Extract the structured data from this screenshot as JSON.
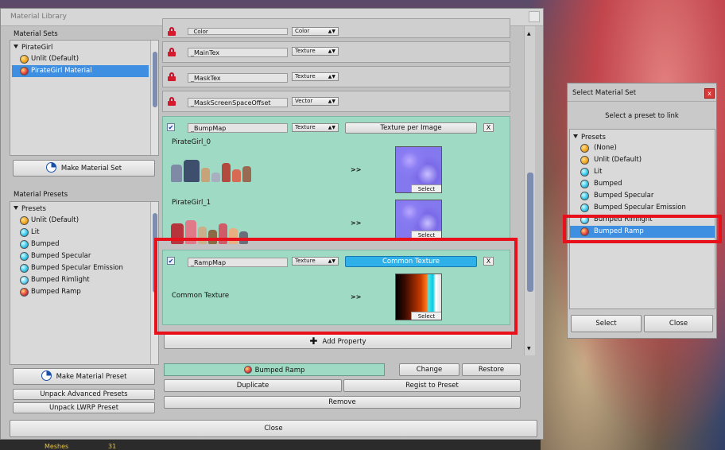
{
  "window": {
    "title": "Material Library",
    "close_label": "Close"
  },
  "material_sets": {
    "label": "Material Sets",
    "root": "PirateGirl",
    "items": [
      {
        "label": "Unlit (Default)",
        "icon": "orange-sphere-icon"
      },
      {
        "label": "PirateGirl Material",
        "icon": "ramp-sphere-icon",
        "selected": true
      }
    ],
    "make_button": "Make Material Set"
  },
  "material_presets": {
    "label": "Material Presets",
    "root": "Presets",
    "items": [
      {
        "label": "Unlit (Default)",
        "icon": "orange-sphere-icon"
      },
      {
        "label": "Lit",
        "icon": "cyan-sphere-icon"
      },
      {
        "label": "Bumped",
        "icon": "cyan-sphere-icon"
      },
      {
        "label": "Bumped Specular",
        "icon": "cyan-sphere-icon"
      },
      {
        "label": "Bumped Specular Emission",
        "icon": "cyan-sphere-icon"
      },
      {
        "label": "Bumped Rimlight",
        "icon": "rim-sphere-icon"
      },
      {
        "label": "Bumped Ramp",
        "icon": "ramp-sphere-icon"
      }
    ],
    "make_button": "Make Material Preset",
    "unpack_advanced": "Unpack Advanced Presets",
    "unpack_lwrp": "Unpack LWRP Preset"
  },
  "properties": {
    "color": {
      "name": "_Color",
      "type": "Color"
    },
    "maintex": {
      "name": "_MainTex",
      "type": "Texture"
    },
    "masktex": {
      "name": "_MaskTex",
      "type": "Texture"
    },
    "maskscreen": {
      "name": "_MaskScreenSpaceOffset",
      "type": "Vector"
    },
    "bumpmap": {
      "name": "_BumpMap",
      "type": "Texture",
      "mode": "Texture per Image",
      "remove": "X",
      "entries": [
        {
          "label": "PirateGirl_0",
          "arrow": ">>",
          "select": "Select"
        },
        {
          "label": "PirateGirl_1",
          "arrow": ">>",
          "select": "Select"
        }
      ]
    },
    "rampmap": {
      "name": "_RampMap",
      "type": "Texture",
      "mode": "Common Texture",
      "remove": "X",
      "entry": {
        "label": "Common Texture",
        "arrow": ">>",
        "select": "Select"
      }
    },
    "add_property": "Add Property"
  },
  "bottom": {
    "current_preset": "Bumped Ramp",
    "change": "Change",
    "restore": "Restore",
    "duplicate": "Duplicate",
    "regist": "Regist to Preset",
    "remove": "Remove"
  },
  "dialog": {
    "title": "Select Material Set",
    "close": "x",
    "subtitle": "Select a preset to link",
    "root": "Presets",
    "items": [
      {
        "label": "(None)",
        "icon": "orange-sphere-icon"
      },
      {
        "label": "Unlit (Default)",
        "icon": "orange-sphere-icon"
      },
      {
        "label": "Lit",
        "icon": "cyan-sphere-icon"
      },
      {
        "label": "Bumped",
        "icon": "cyan-sphere-icon"
      },
      {
        "label": "Bumped Specular",
        "icon": "cyan-sphere-icon"
      },
      {
        "label": "Bumped Specular Emission",
        "icon": "cyan-sphere-icon"
      },
      {
        "label": "Bumped Rimlight",
        "icon": "rim-sphere-icon"
      },
      {
        "label": "Bumped Ramp",
        "icon": "ramp-sphere-icon",
        "selected": true
      }
    ],
    "select": "Select",
    "close_button": "Close"
  },
  "background": {
    "stat_label": "Meshes",
    "stat_value": "31"
  },
  "colors": {
    "selection": "#3e8ee2",
    "teal_panel": "#9fdac4",
    "highlight": "#e8101a",
    "common_texture_button": "#2fb0e8"
  }
}
